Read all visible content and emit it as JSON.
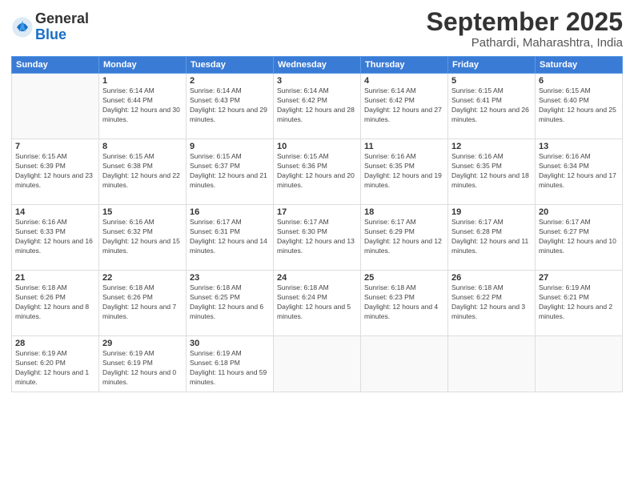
{
  "logo": {
    "general": "General",
    "blue": "Blue"
  },
  "header": {
    "month": "September 2025",
    "location": "Pathardi, Maharashtra, India"
  },
  "weekdays": [
    "Sunday",
    "Monday",
    "Tuesday",
    "Wednesday",
    "Thursday",
    "Friday",
    "Saturday"
  ],
  "weeks": [
    [
      {
        "day": "",
        "sunrise": "",
        "sunset": "",
        "daylight": ""
      },
      {
        "day": "1",
        "sunrise": "Sunrise: 6:14 AM",
        "sunset": "Sunset: 6:44 PM",
        "daylight": "Daylight: 12 hours and 30 minutes."
      },
      {
        "day": "2",
        "sunrise": "Sunrise: 6:14 AM",
        "sunset": "Sunset: 6:43 PM",
        "daylight": "Daylight: 12 hours and 29 minutes."
      },
      {
        "day": "3",
        "sunrise": "Sunrise: 6:14 AM",
        "sunset": "Sunset: 6:42 PM",
        "daylight": "Daylight: 12 hours and 28 minutes."
      },
      {
        "day": "4",
        "sunrise": "Sunrise: 6:14 AM",
        "sunset": "Sunset: 6:42 PM",
        "daylight": "Daylight: 12 hours and 27 minutes."
      },
      {
        "day": "5",
        "sunrise": "Sunrise: 6:15 AM",
        "sunset": "Sunset: 6:41 PM",
        "daylight": "Daylight: 12 hours and 26 minutes."
      },
      {
        "day": "6",
        "sunrise": "Sunrise: 6:15 AM",
        "sunset": "Sunset: 6:40 PM",
        "daylight": "Daylight: 12 hours and 25 minutes."
      }
    ],
    [
      {
        "day": "7",
        "sunrise": "Sunrise: 6:15 AM",
        "sunset": "Sunset: 6:39 PM",
        "daylight": "Daylight: 12 hours and 23 minutes."
      },
      {
        "day": "8",
        "sunrise": "Sunrise: 6:15 AM",
        "sunset": "Sunset: 6:38 PM",
        "daylight": "Daylight: 12 hours and 22 minutes."
      },
      {
        "day": "9",
        "sunrise": "Sunrise: 6:15 AM",
        "sunset": "Sunset: 6:37 PM",
        "daylight": "Daylight: 12 hours and 21 minutes."
      },
      {
        "day": "10",
        "sunrise": "Sunrise: 6:15 AM",
        "sunset": "Sunset: 6:36 PM",
        "daylight": "Daylight: 12 hours and 20 minutes."
      },
      {
        "day": "11",
        "sunrise": "Sunrise: 6:16 AM",
        "sunset": "Sunset: 6:35 PM",
        "daylight": "Daylight: 12 hours and 19 minutes."
      },
      {
        "day": "12",
        "sunrise": "Sunrise: 6:16 AM",
        "sunset": "Sunset: 6:35 PM",
        "daylight": "Daylight: 12 hours and 18 minutes."
      },
      {
        "day": "13",
        "sunrise": "Sunrise: 6:16 AM",
        "sunset": "Sunset: 6:34 PM",
        "daylight": "Daylight: 12 hours and 17 minutes."
      }
    ],
    [
      {
        "day": "14",
        "sunrise": "Sunrise: 6:16 AM",
        "sunset": "Sunset: 6:33 PM",
        "daylight": "Daylight: 12 hours and 16 minutes."
      },
      {
        "day": "15",
        "sunrise": "Sunrise: 6:16 AM",
        "sunset": "Sunset: 6:32 PM",
        "daylight": "Daylight: 12 hours and 15 minutes."
      },
      {
        "day": "16",
        "sunrise": "Sunrise: 6:17 AM",
        "sunset": "Sunset: 6:31 PM",
        "daylight": "Daylight: 12 hours and 14 minutes."
      },
      {
        "day": "17",
        "sunrise": "Sunrise: 6:17 AM",
        "sunset": "Sunset: 6:30 PM",
        "daylight": "Daylight: 12 hours and 13 minutes."
      },
      {
        "day": "18",
        "sunrise": "Sunrise: 6:17 AM",
        "sunset": "Sunset: 6:29 PM",
        "daylight": "Daylight: 12 hours and 12 minutes."
      },
      {
        "day": "19",
        "sunrise": "Sunrise: 6:17 AM",
        "sunset": "Sunset: 6:28 PM",
        "daylight": "Daylight: 12 hours and 11 minutes."
      },
      {
        "day": "20",
        "sunrise": "Sunrise: 6:17 AM",
        "sunset": "Sunset: 6:27 PM",
        "daylight": "Daylight: 12 hours and 10 minutes."
      }
    ],
    [
      {
        "day": "21",
        "sunrise": "Sunrise: 6:18 AM",
        "sunset": "Sunset: 6:26 PM",
        "daylight": "Daylight: 12 hours and 8 minutes."
      },
      {
        "day": "22",
        "sunrise": "Sunrise: 6:18 AM",
        "sunset": "Sunset: 6:26 PM",
        "daylight": "Daylight: 12 hours and 7 minutes."
      },
      {
        "day": "23",
        "sunrise": "Sunrise: 6:18 AM",
        "sunset": "Sunset: 6:25 PM",
        "daylight": "Daylight: 12 hours and 6 minutes."
      },
      {
        "day": "24",
        "sunrise": "Sunrise: 6:18 AM",
        "sunset": "Sunset: 6:24 PM",
        "daylight": "Daylight: 12 hours and 5 minutes."
      },
      {
        "day": "25",
        "sunrise": "Sunrise: 6:18 AM",
        "sunset": "Sunset: 6:23 PM",
        "daylight": "Daylight: 12 hours and 4 minutes."
      },
      {
        "day": "26",
        "sunrise": "Sunrise: 6:18 AM",
        "sunset": "Sunset: 6:22 PM",
        "daylight": "Daylight: 12 hours and 3 minutes."
      },
      {
        "day": "27",
        "sunrise": "Sunrise: 6:19 AM",
        "sunset": "Sunset: 6:21 PM",
        "daylight": "Daylight: 12 hours and 2 minutes."
      }
    ],
    [
      {
        "day": "28",
        "sunrise": "Sunrise: 6:19 AM",
        "sunset": "Sunset: 6:20 PM",
        "daylight": "Daylight: 12 hours and 1 minute."
      },
      {
        "day": "29",
        "sunrise": "Sunrise: 6:19 AM",
        "sunset": "Sunset: 6:19 PM",
        "daylight": "Daylight: 12 hours and 0 minutes."
      },
      {
        "day": "30",
        "sunrise": "Sunrise: 6:19 AM",
        "sunset": "Sunset: 6:18 PM",
        "daylight": "Daylight: 11 hours and 59 minutes."
      },
      {
        "day": "",
        "sunrise": "",
        "sunset": "",
        "daylight": ""
      },
      {
        "day": "",
        "sunrise": "",
        "sunset": "",
        "daylight": ""
      },
      {
        "day": "",
        "sunrise": "",
        "sunset": "",
        "daylight": ""
      },
      {
        "day": "",
        "sunrise": "",
        "sunset": "",
        "daylight": ""
      }
    ]
  ]
}
